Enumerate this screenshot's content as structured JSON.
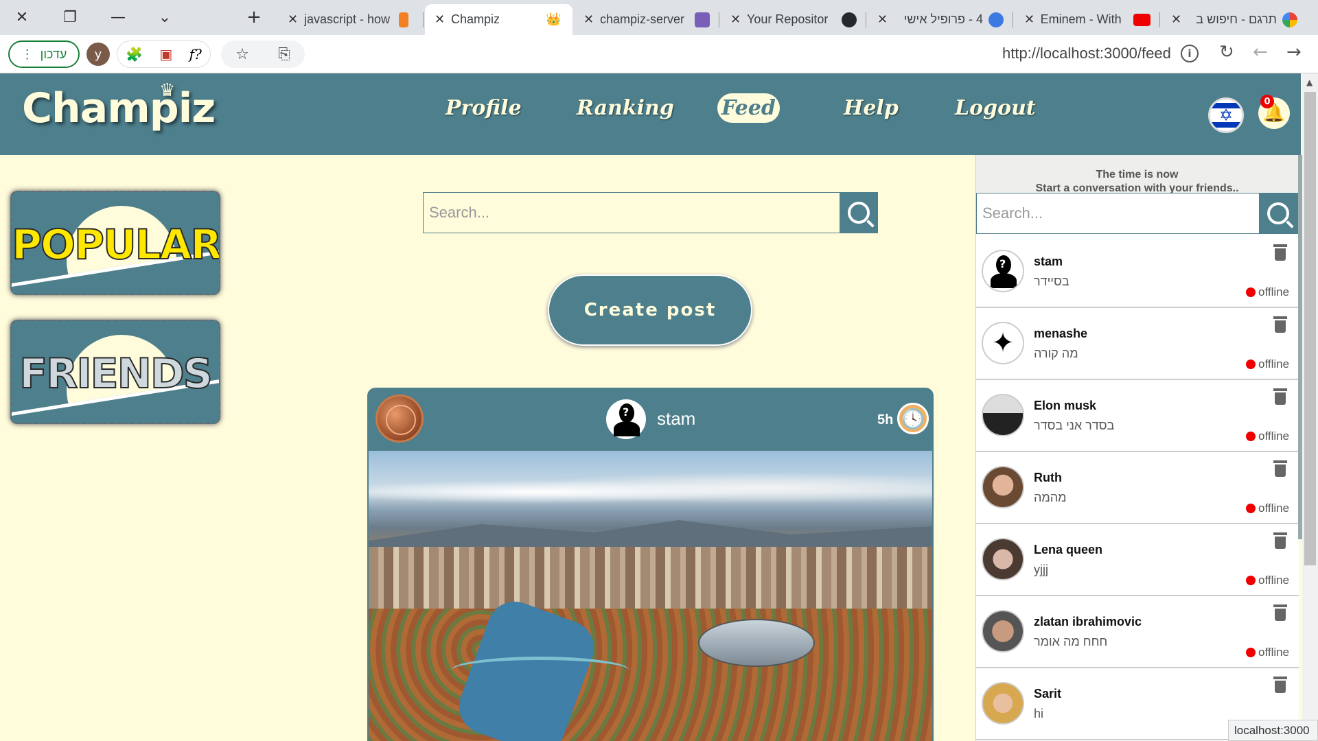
{
  "browser": {
    "tabs": [
      {
        "title": "javascript - how",
        "active": false
      },
      {
        "title": "Champiz",
        "active": true
      },
      {
        "title": "champiz-server",
        "active": false
      },
      {
        "title": "Your Repositor",
        "active": false
      },
      {
        "title": "4 - פרופיל אישי",
        "active": false
      },
      {
        "title": "Eminem - With",
        "active": false
      },
      {
        "title": "תרגם - חיפוש ב",
        "active": false
      }
    ],
    "update_label": "עדכון",
    "profile_initial": "y",
    "ext_f": "f?",
    "url": "http://localhost:3000/feed",
    "status_url": "localhost:3000"
  },
  "header": {
    "logo": "Champiz",
    "nav": [
      {
        "label": "Profile",
        "active": false
      },
      {
        "label": "Ranking",
        "active": false
      },
      {
        "label": "Feed",
        "active": true
      },
      {
        "label": "Help",
        "active": false
      },
      {
        "label": "Logout",
        "active": false
      }
    ],
    "notification_count": "0"
  },
  "sidebar": {
    "cards": [
      "POPULAR",
      "FRIENDS"
    ]
  },
  "feed": {
    "search_placeholder": "Search...",
    "create_post": "Create post",
    "post": {
      "author": "stam",
      "time": "5h"
    }
  },
  "chat": {
    "header_line1": "The time is now",
    "header_line2": "Start a conversation with your friends..",
    "search_placeholder": "Search...",
    "contacts": [
      {
        "name": "stam",
        "message": "בסיידר",
        "status": "offline"
      },
      {
        "name": "menashe",
        "message": "מה קורה",
        "status": "offline"
      },
      {
        "name": "Elon musk",
        "message": "בסדר אני בסדר",
        "status": "offline"
      },
      {
        "name": "Ruth",
        "message": "מהמה",
        "status": "offline"
      },
      {
        "name": "Lena queen",
        "message": "yjjj",
        "status": "offline"
      },
      {
        "name": "zlatan ibrahimovic",
        "message": "חחח מה אומר",
        "status": "offline"
      },
      {
        "name": "Sarit",
        "message": "hi",
        "status": ""
      }
    ]
  },
  "colors": {
    "brand": "#4e7f8c",
    "background": "#fffcdc",
    "offline": "#ee0000"
  }
}
